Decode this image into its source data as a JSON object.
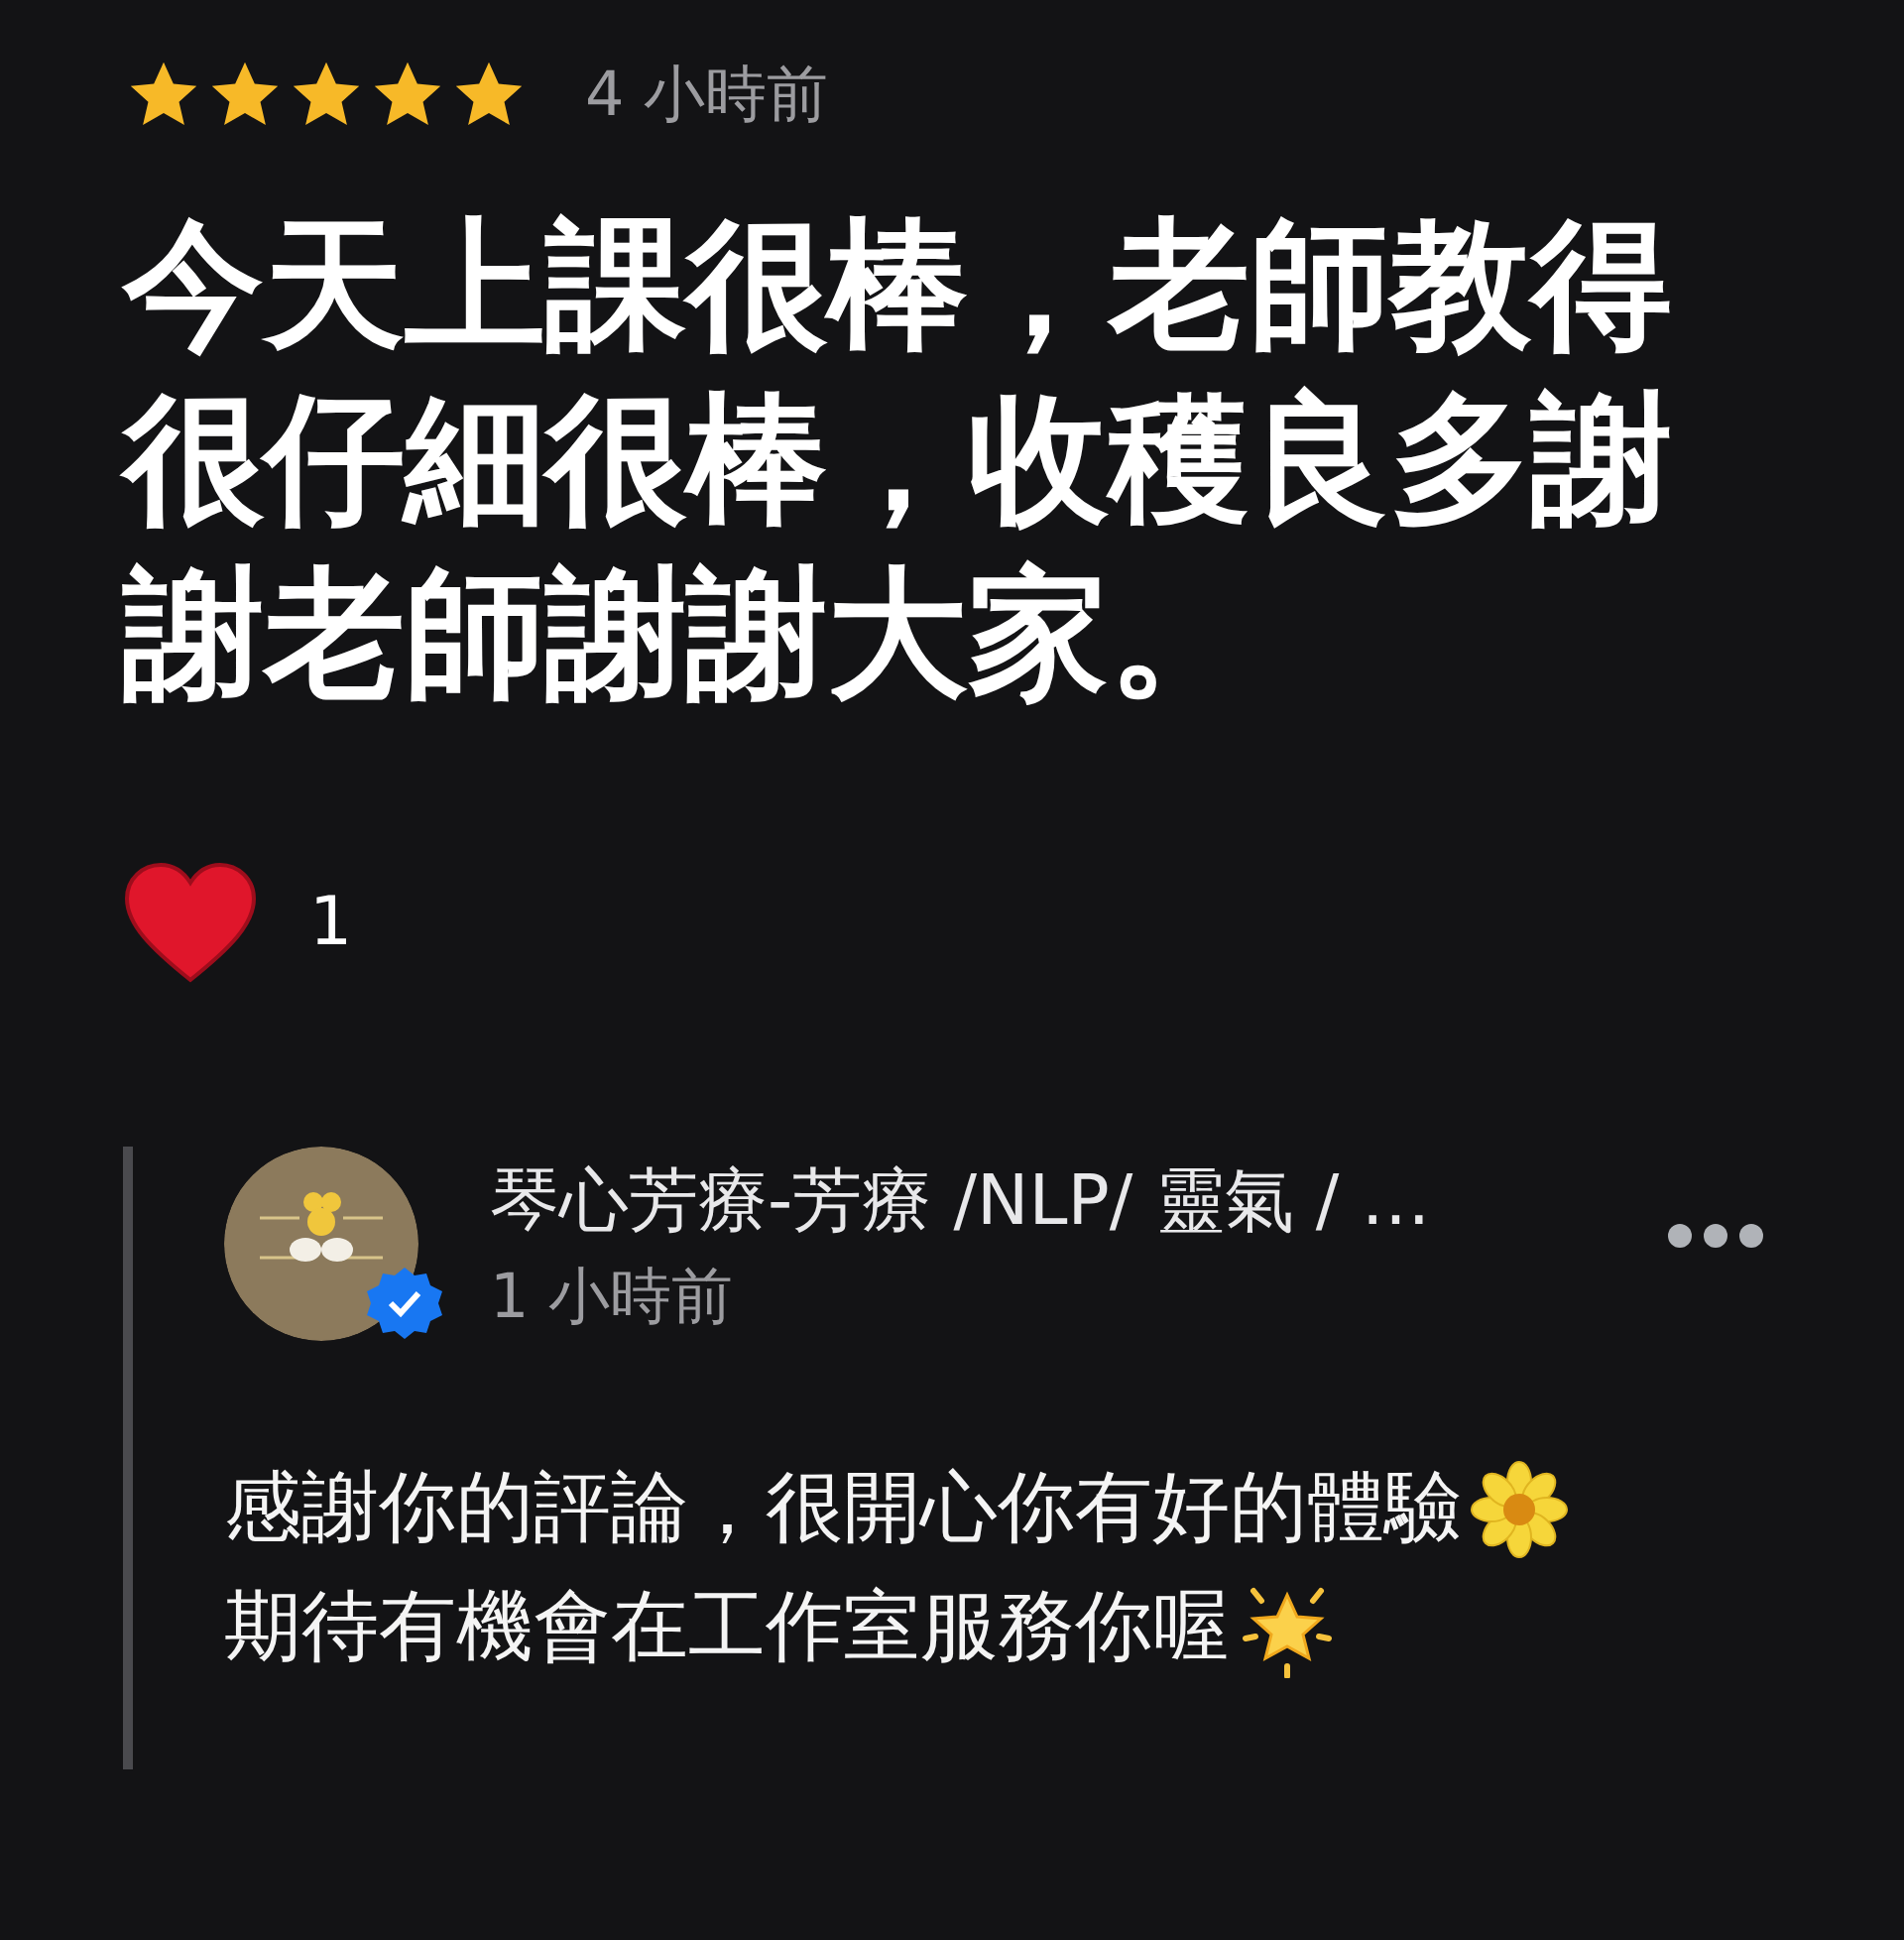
{
  "review": {
    "stars": 5,
    "time": "4 小時前",
    "text": "今天上課很棒，老師教得很仔細很棒，收穫良多謝謝老師謝謝大家。",
    "reactions": {
      "count": "1"
    }
  },
  "reply": {
    "author": "琴心芳療-芳療 /NLP/ 靈氣 / …",
    "verified": true,
    "time": "1 小時前",
    "lines": [
      {
        "text": "感謝你的評論，很開心你有好的體驗",
        "kind": "flower"
      },
      {
        "text": "期待有機會在工作室服務你喔",
        "kind": "sparkle"
      }
    ]
  }
}
